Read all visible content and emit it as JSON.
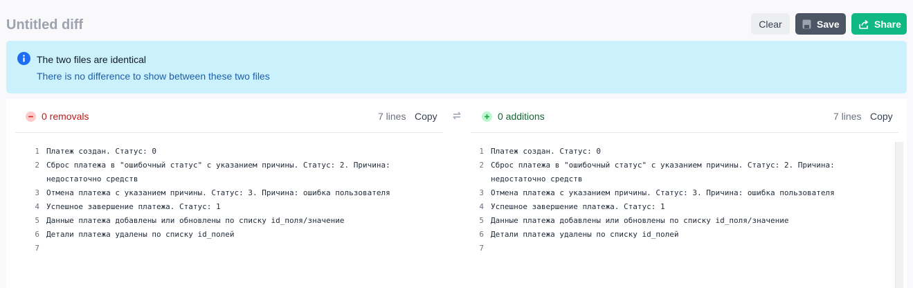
{
  "header": {
    "title": "Untitled diff",
    "clear_label": "Clear",
    "save_label": "Save",
    "share_label": "Share"
  },
  "alert": {
    "title": "The two files are identical",
    "text": "There is no difference to show between these two files"
  },
  "left": {
    "count_label": "0 removals",
    "lines_label": "7 lines",
    "copy_label": "Copy",
    "rows": [
      {
        "n": "1",
        "t": "Платеж создан. Статус: 0"
      },
      {
        "n": "2",
        "t": "Сброс платежа в \"ошибочный статус\" с указанием причины. Статус: 2. Причина: недостаточно средств"
      },
      {
        "n": "3",
        "t": "Отмена платежа с указанием причины. Статус: 3. Причина: ошибка пользователя"
      },
      {
        "n": "4",
        "t": "Успешное завершение платежа. Статус: 1"
      },
      {
        "n": "5",
        "t": "Данные платежа добавлены или обновлены по списку id_поля/значение"
      },
      {
        "n": "6",
        "t": "Детали платежа удалены по списку id_полей"
      },
      {
        "n": "7",
        "t": ""
      }
    ]
  },
  "right": {
    "count_label": "0 additions",
    "lines_label": "7 lines",
    "copy_label": "Copy",
    "rows": [
      {
        "n": "1",
        "t": "Платеж создан. Статус: 0"
      },
      {
        "n": "2",
        "t": "Сброс платежа в \"ошибочный статус\" с указанием причины. Статус: 2. Причина: недостаточно средств"
      },
      {
        "n": "3",
        "t": "Отмена платежа с указанием причины. Статус: 3. Причина: ошибка пользователя"
      },
      {
        "n": "4",
        "t": "Успешное завершение платежа. Статус: 1"
      },
      {
        "n": "5",
        "t": "Данные платежа добавлены или обновлены по списку id_поля/значение"
      },
      {
        "n": "6",
        "t": "Детали платежа удалены по списку id_полей"
      },
      {
        "n": "7",
        "t": ""
      }
    ]
  },
  "colors": {
    "save": "#4b5563",
    "share": "#10b981",
    "alert_bg": "#cbf1fc",
    "removals": "#b91c1c",
    "additions": "#166534"
  },
  "icons": {
    "save": "floppy-disk-icon",
    "share": "share-icon",
    "alert": "info-icon",
    "swap": "swap-arrows-icon"
  }
}
